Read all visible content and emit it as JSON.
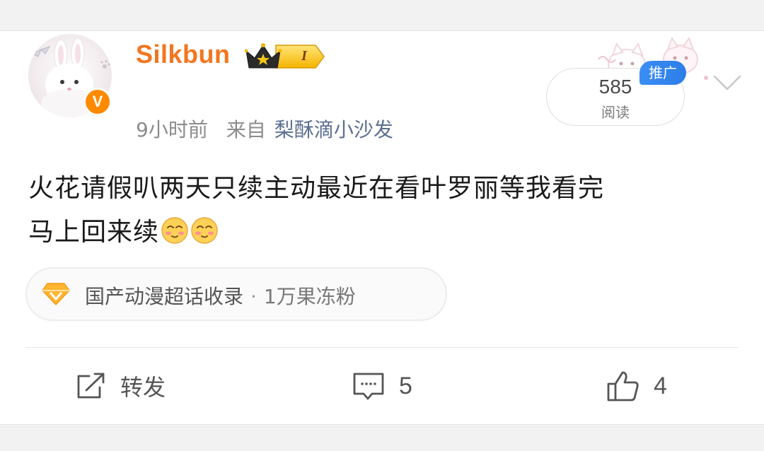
{
  "post": {
    "author": {
      "name": "Silkbun",
      "vip_level": "I",
      "verified": "V"
    },
    "meta": {
      "time": "9小时前",
      "from_label": "来自",
      "source": "梨酥滴小沙发"
    },
    "read": {
      "count": "585",
      "label": "阅读",
      "promo_tag": "推广"
    },
    "text_line1": "火花请假叭两天只续主动最近在看叶罗丽等我看完",
    "text_line2": "马上回来续",
    "emojis": [
      "blush-face-icon",
      "blush-face-icon"
    ],
    "topic": {
      "name": "国产动漫超话收录",
      "separator": "·",
      "fans": "1万果冻粉"
    },
    "actions": {
      "repost_label": "转发",
      "comment_count": "5",
      "like_count": "4"
    }
  },
  "colors": {
    "username": "#f2761f",
    "source_link": "#5b6f91",
    "promo_tag": "#3b8ef5",
    "verified_badge": "#ff8a00",
    "vip_badge": "#f5b400"
  }
}
